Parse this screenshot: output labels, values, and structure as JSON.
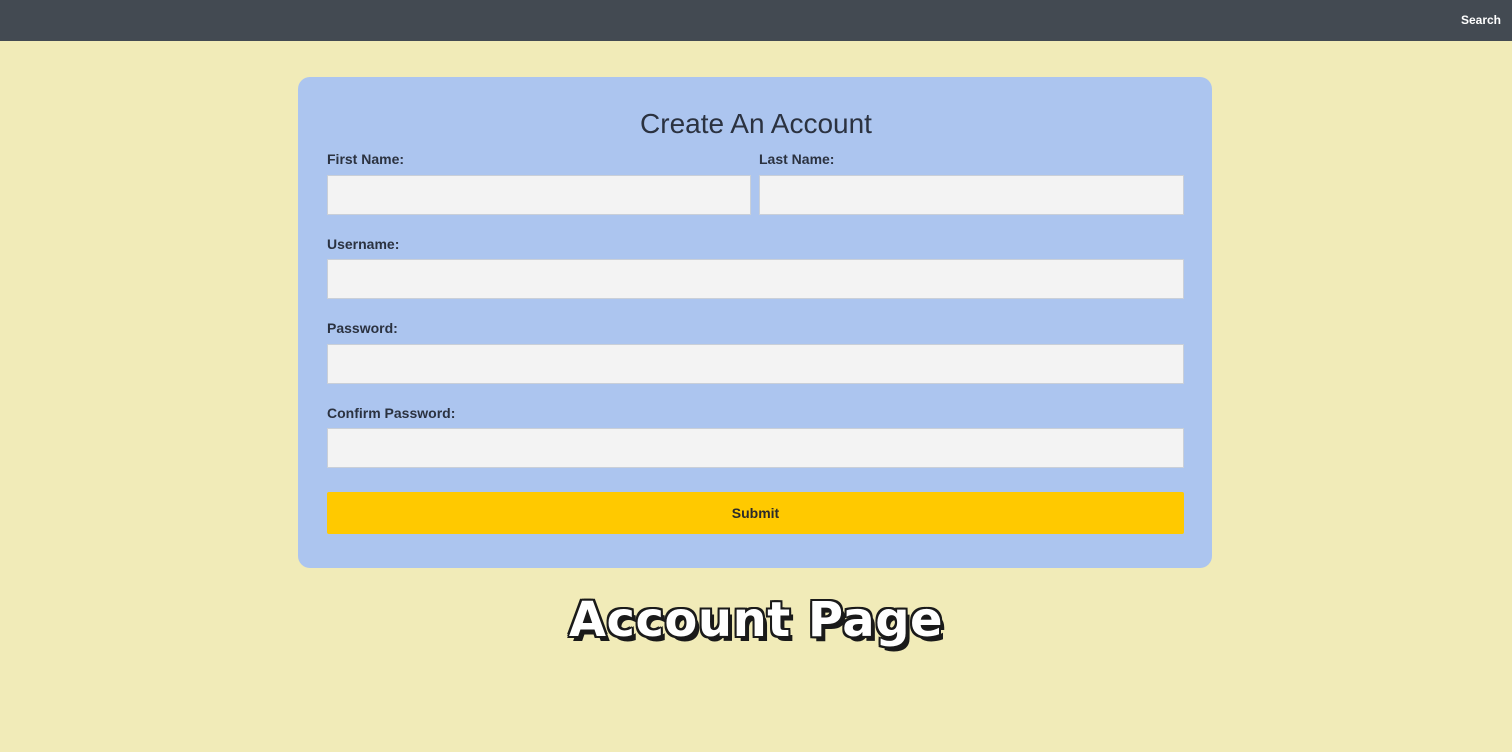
{
  "topbar": {
    "search_label": "Search"
  },
  "form": {
    "title": "Create An Account",
    "first_name_label": "First Name:",
    "last_name_label": "Last Name:",
    "username_label": "Username:",
    "password_label": "Password:",
    "confirm_password_label": "Confirm Password:",
    "first_name_value": "",
    "last_name_value": "",
    "username_value": "",
    "password_value": "",
    "confirm_password_value": "",
    "submit_label": "Submit"
  },
  "caption": {
    "text": "Account Page"
  },
  "colors": {
    "page_background": "#f1ebb8",
    "topbar_background": "#434a52",
    "card_background": "#acc5ef",
    "input_background": "#f3f3f3",
    "submit_background": "#ffc900"
  }
}
